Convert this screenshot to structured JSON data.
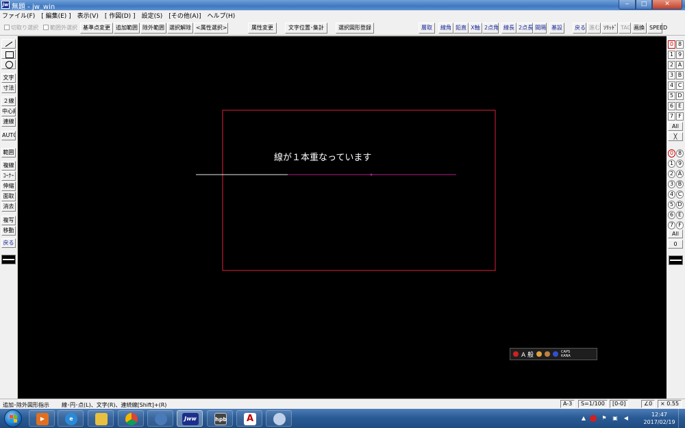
{
  "window": {
    "title": "無題 - jw_win",
    "app_icon_text": "jw",
    "min_glyph": "‒",
    "max_glyph": "□",
    "close_glyph": "✕"
  },
  "menu": [
    "ファイル(F)",
    "[ 編集(E) ]",
    "表示(V)",
    "[ 作図(D) ]",
    "設定(S)",
    "[その他(A)]",
    "ヘルプ(H)"
  ],
  "toolbar": {
    "chk_cut_select": "切取り選択",
    "chk_outside_select": "範囲外選択",
    "base_point": "基準点変更",
    "add_range": "追加範囲",
    "exclude_range": "除外範囲",
    "clear_select": "選択解除",
    "attr_select": "<属性選択>",
    "attr_change": "属性変更",
    "text_pos": "文字位置･集計",
    "register_shape": "選択図形登録",
    "right": [
      "層取",
      "線角",
      "鉛直",
      "X軸",
      "2点角",
      "線長",
      "2点長",
      "間隔",
      "基設"
    ],
    "right2": [
      "戻る",
      "進む",
      "ｿﾘｯﾄﾞ",
      "TAG",
      "画換",
      "SPEED"
    ]
  },
  "left_tools": [
    "／",
    "□",
    "○",
    "文字",
    "寸法",
    "２線",
    "中心線",
    "連線",
    "AUTO",
    "範囲",
    "複線",
    "ｺｰﾅｰ",
    "伸縮",
    "面取",
    "消去",
    "複写",
    "移動",
    "戻る"
  ],
  "right_tools": {
    "layers_a": [
      "0",
      "1",
      "2",
      "3",
      "4",
      "5",
      "6",
      "7"
    ],
    "layers_b": [
      "8",
      "9",
      "A",
      "B",
      "C",
      "D",
      "E",
      "F"
    ],
    "all": "All",
    "cross": "╳",
    "groups_a": [
      "0",
      "1",
      "2",
      "3",
      "4",
      "5",
      "6",
      "7"
    ],
    "groups_b": [
      "8",
      "9",
      "A",
      "B",
      "C",
      "D",
      "E",
      "F"
    ],
    "all2": "All",
    "zero": "0"
  },
  "canvas": {
    "annotation": "線が１本重なっています",
    "background": "#000000",
    "rect_color": "#e0203a",
    "line_white": "#e8e8e8",
    "line_magenta": "#b0208a"
  },
  "ime": {
    "mode": "A 般",
    "caps": "CAPS",
    "kana": "KANA"
  },
  "status": {
    "left": "追加･除外図形指示",
    "hint": "線･円･点(L)、文字(R)、連続線[Shift]+(R)",
    "paper": "A-3",
    "scale": "S=1/100",
    "layer": "[0-0]",
    "angle": "∠0",
    "zoom": "× 0.55"
  },
  "taskbar": {
    "apps": [
      "media-player",
      "internet-explorer",
      "file-explorer",
      "chrome",
      "thunderbird",
      "jw-cad",
      "hpb",
      "acrobat",
      "paint"
    ],
    "jw_label": "Jww",
    "hpb_label": "hpb",
    "acrobat_label": "A",
    "time": "12:47",
    "date": "2017/02/19",
    "tray_up": "▲"
  }
}
